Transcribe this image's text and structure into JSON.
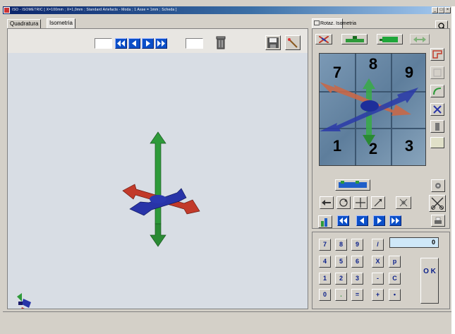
{
  "window": {
    "title": "ISO - ISOMETRIC   [ X=100mm ; X=1,0mm ; Standard Artefacts - Moda ; 1 Asse = 1mm ; Scheda ]",
    "min_label": "_",
    "max_label": "□",
    "close_label": "×"
  },
  "tabs_left": [
    {
      "label": "Quadratura",
      "active": false
    },
    {
      "label": "Isometria",
      "active": true
    }
  ],
  "tab_right": {
    "label": "Rotaz. Isometria"
  },
  "cube_numbers": [
    "7",
    "8",
    "9",
    "1",
    "2",
    "3"
  ],
  "keypad": {
    "rows": [
      [
        "7",
        "8",
        "9",
        "/"
      ],
      [
        "4",
        "5",
        "6",
        "X",
        "p"
      ],
      [
        "1",
        "2",
        "3",
        "-",
        "C"
      ],
      [
        "0",
        ".",
        "=",
        "+",
        "•"
      ]
    ],
    "display": "0",
    "ok_label": "O K"
  },
  "icons": {
    "nav": [
      "rewind-icon",
      "step-back-icon",
      "step-forward-icon",
      "fast-forward-icon"
    ],
    "tools": [
      "trash-icon",
      "save-icon",
      "wand-icon",
      "search-icon",
      "magnet-icon"
    ]
  },
  "colors": {
    "accent_blue": "#0b4fc8",
    "title_blue": "#0a246a",
    "arrow_green": "#2e9a3a",
    "arrow_red": "#c23a2a",
    "arrow_blue": "#2834a8"
  }
}
